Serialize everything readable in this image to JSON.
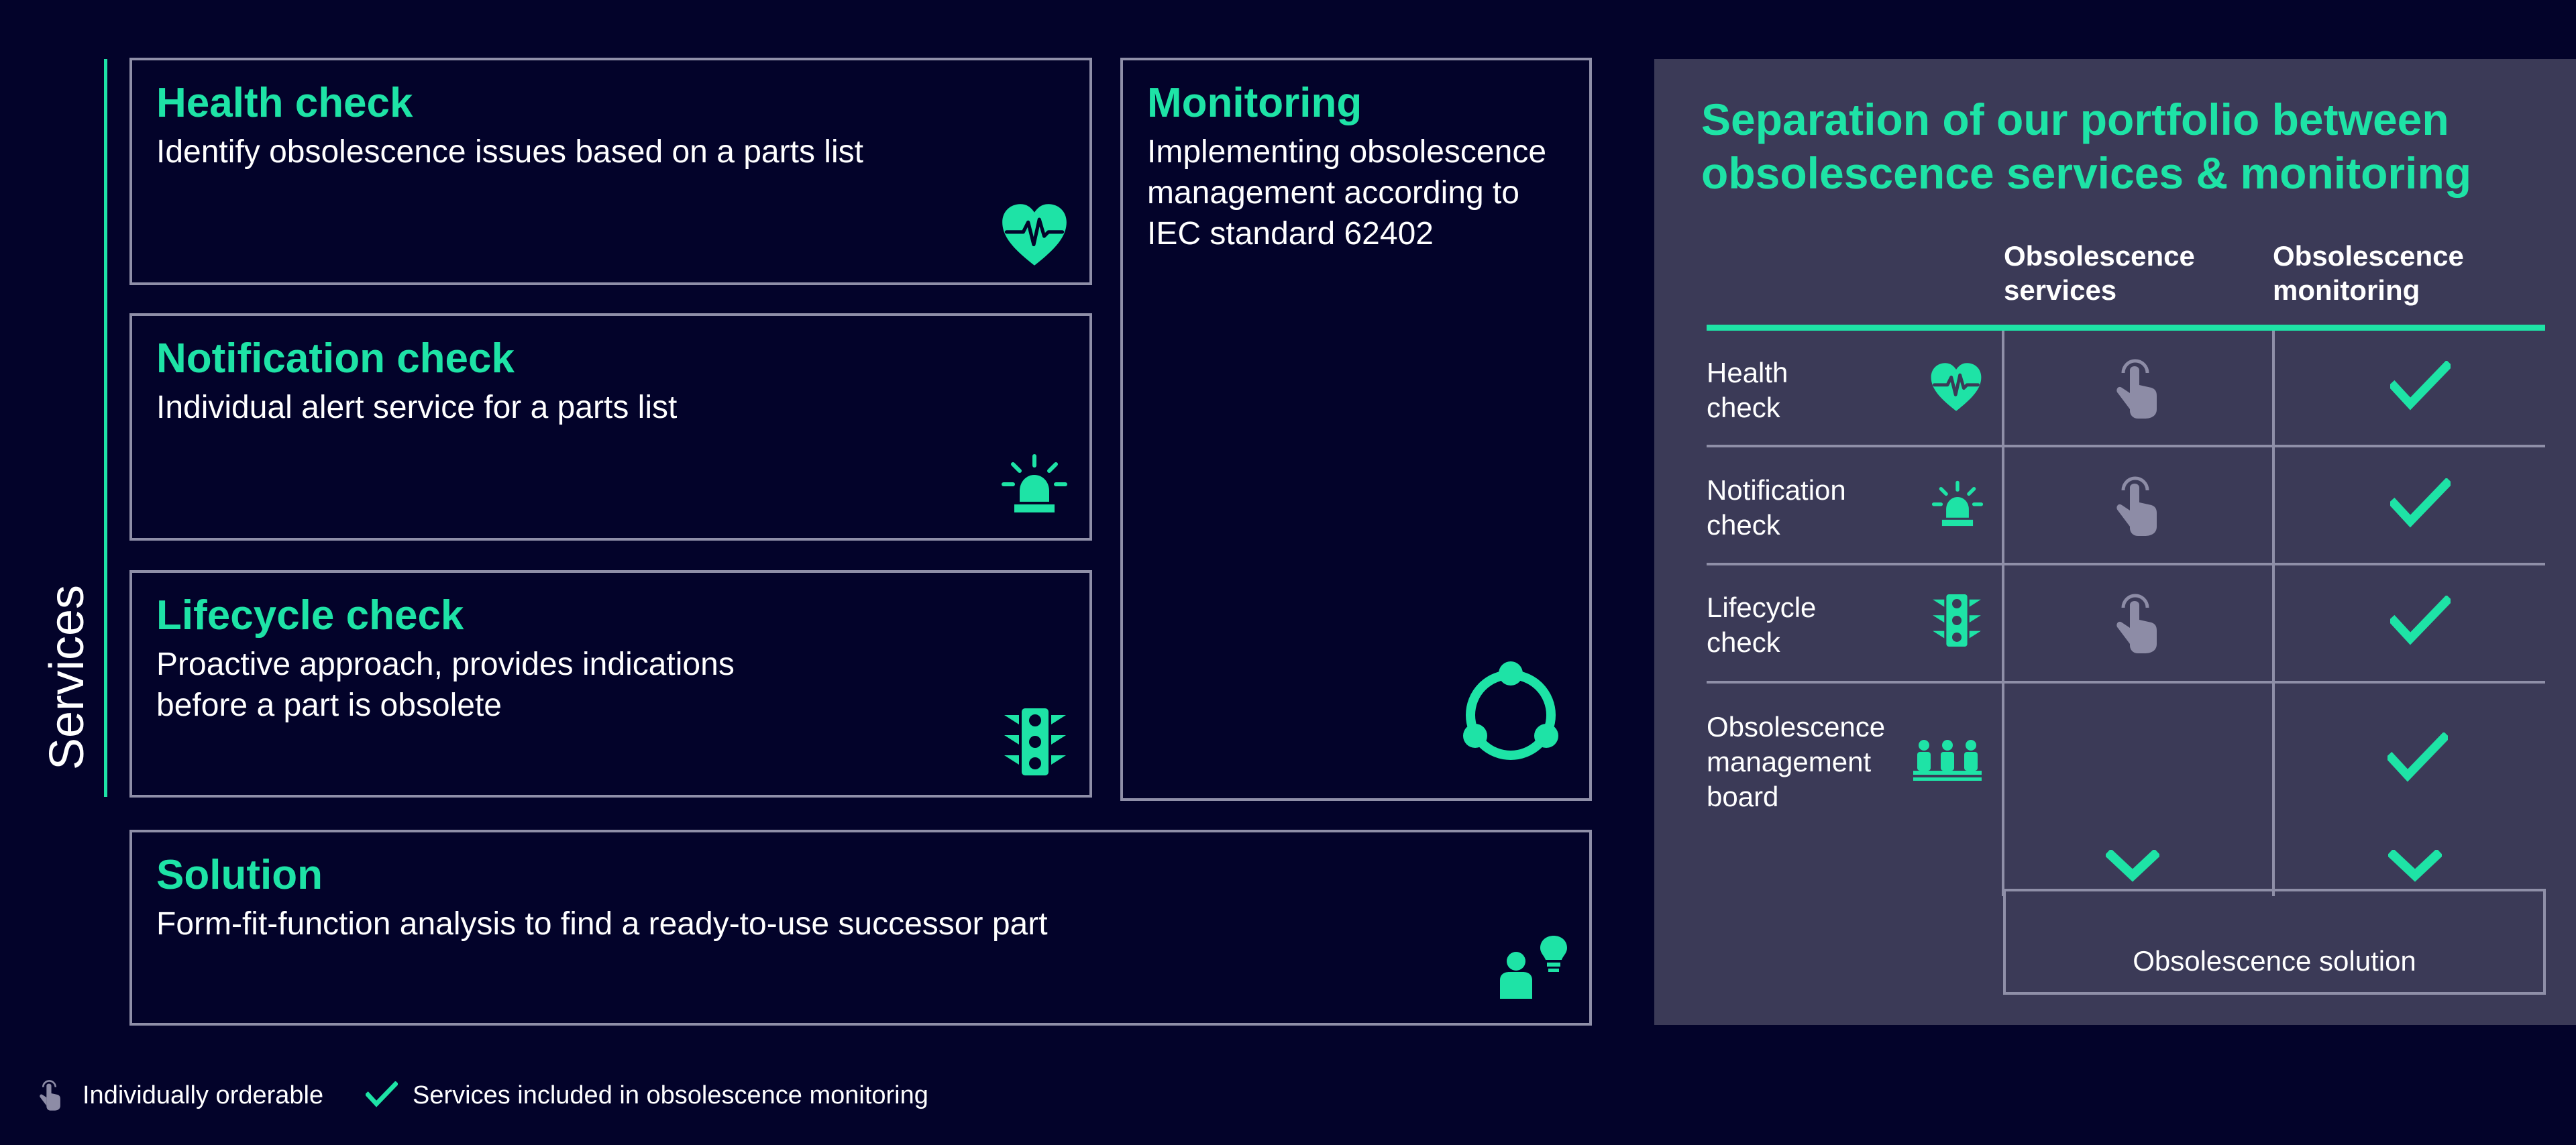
{
  "services_label": "Services",
  "cards": {
    "health": {
      "title": "Health check",
      "desc": "Identify obsolescence issues based on a parts list",
      "icon": "heart-pulse-icon"
    },
    "notification": {
      "title": "Notification check",
      "desc": "Individual alert service for a parts list",
      "icon": "alarm-light-icon"
    },
    "lifecycle": {
      "title": "Lifecycle check",
      "desc_line1": "Proactive approach, provides indications",
      "desc_line2": "before a part is obsolete",
      "icon": "traffic-light-icon"
    },
    "monitoring": {
      "title": "Monitoring",
      "desc_line1": "Implementing obsolescence",
      "desc_line2": "management according to",
      "desc_line3": "IEC standard 62402",
      "icon": "cycle-icon"
    },
    "solution": {
      "title": "Solution",
      "desc": "Form-fit-function analysis to find a ready-to-use successor part",
      "icon": "person-idea-icon"
    }
  },
  "panel": {
    "title_line1": "Separation of our portfolio between",
    "title_line2": "obsolescence services & monitoring",
    "col1_line1": "Obsolescence",
    "col1_line2": "services",
    "col2_line1": "Obsolescence",
    "col2_line2": "monitoring",
    "rows": [
      {
        "line1": "Health",
        "line2": "check",
        "icon": "heart-pulse-icon",
        "services": "hand-pointer-icon",
        "monitoring": "checkmark-icon"
      },
      {
        "line1": "Notification",
        "line2": "check",
        "icon": "alarm-light-icon",
        "services": "hand-pointer-icon",
        "monitoring": "checkmark-icon"
      },
      {
        "line1": "Lifecycle",
        "line2": "check",
        "icon": "traffic-light-icon",
        "services": "hand-pointer-icon",
        "monitoring": "checkmark-icon"
      },
      {
        "line1": "Obsolescence",
        "line2": "management",
        "line3": "board",
        "icon": "board-people-icon",
        "services": "",
        "monitoring": "checkmark-icon"
      }
    ],
    "solution_box": "Obsolescence solution"
  },
  "legend": {
    "individually_orderable": "Individually orderable",
    "included": "Services included in obsolescence monitoring"
  },
  "colors": {
    "accent": "#1ee3a6",
    "background": "#03032a",
    "panel": "#3b3a57",
    "border": "#8f8fa8",
    "muted_icon": "#8d8ca6"
  }
}
